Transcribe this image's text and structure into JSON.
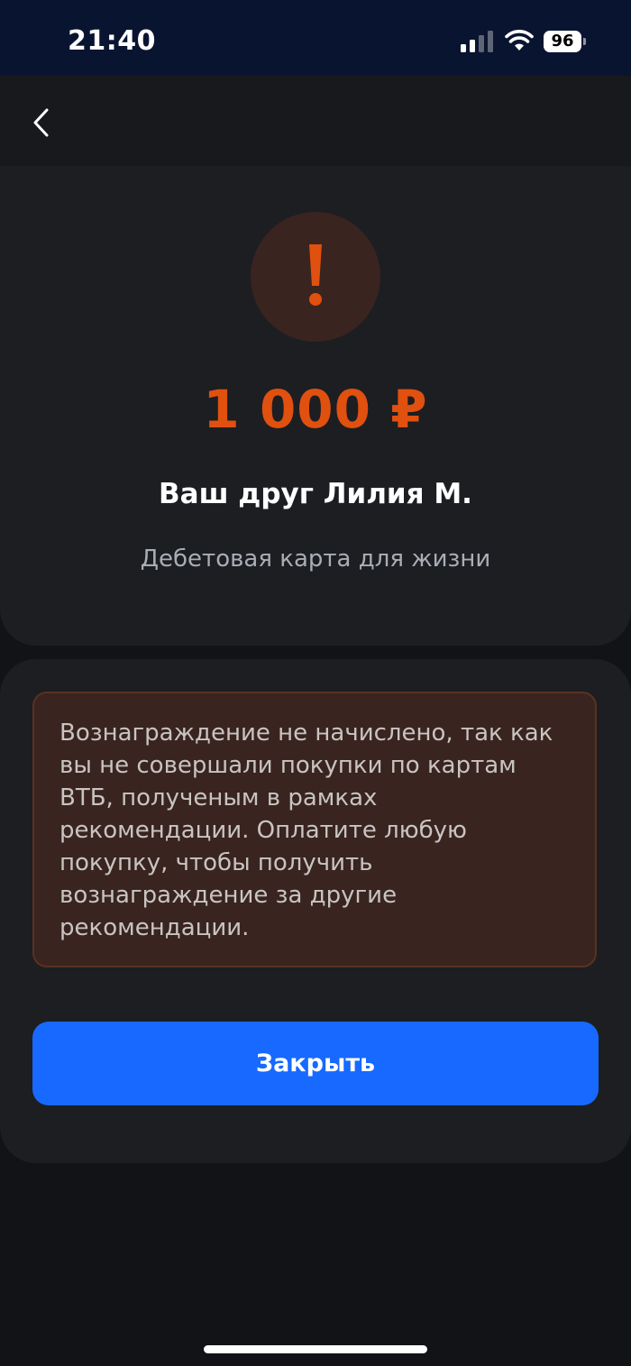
{
  "status_bar": {
    "time": "21:40",
    "battery_level": "96",
    "icons": [
      "signal-icon",
      "wifi-icon",
      "battery-icon"
    ]
  },
  "nav": {
    "back_icon": "chevron-left-icon"
  },
  "reward": {
    "warning_icon": "exclamation-icon",
    "amount": "1 000 ₽",
    "friend_name": "Ваш друг Лилия М.",
    "product_name": "Дебетовая карта для жизни"
  },
  "notice": {
    "text": "Вознаграждение не начислено, так как вы не совершали покупки по картам ВТБ, полученым в рамках рекомендации. Оплатите любую покупку, чтобы получить вознаграждение за другие рекомендации."
  },
  "actions": {
    "close_label": "Закрыть"
  },
  "colors": {
    "accent": "#1769ff",
    "warning": "#e0500f",
    "warning_bg": "#3a241f",
    "background": "#111317",
    "card": "#1c1e22"
  }
}
